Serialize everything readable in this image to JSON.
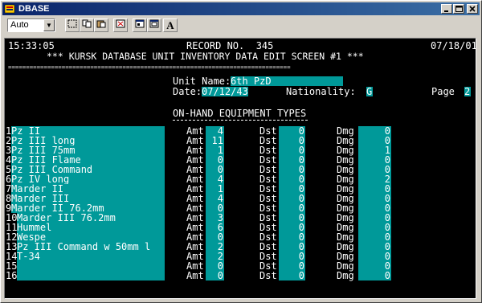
{
  "window": {
    "title": "DBASE"
  },
  "toolbar": {
    "font_size": "Auto",
    "font_size_arrow": "▼",
    "a_label": "A"
  },
  "header": {
    "time": "15:33:05",
    "record": "RECORD NO.  345",
    "date": "07/18/01",
    "subtitle": "*** KURSK DATABASE UNIT INVENTORY DATA EDIT SCREEN #1 ***",
    "divider": "==============================================================================="
  },
  "unit": {
    "name_label": "Unit Name:",
    "name_value": "6th PzD",
    "date_label": "Date:",
    "date_value": "07/12/43",
    "nationality_label": "Nationality:",
    "nationality_value": "G",
    "page_label": "Page",
    "page_value": "2"
  },
  "section": {
    "title": "ON-HAND EQUIPMENT TYPES"
  },
  "labels": {
    "amt": "Amt",
    "dst": "Dst",
    "dmg": "Dmg"
  },
  "rows": [
    {
      "n": "1",
      "name": "Pz II",
      "amt": "4",
      "dst": "0",
      "dmg": "0"
    },
    {
      "n": "2",
      "name": "Pz III long",
      "amt": "11",
      "dst": "0",
      "dmg": "0"
    },
    {
      "n": "3",
      "name": "Pz III 75mm",
      "amt": "1",
      "dst": "0",
      "dmg": "1"
    },
    {
      "n": "4",
      "name": "Pz III Flame",
      "amt": "0",
      "dst": "0",
      "dmg": "0"
    },
    {
      "n": "5",
      "name": "Pz III Command",
      "amt": "0",
      "dst": "0",
      "dmg": "0"
    },
    {
      "n": "6",
      "name": "Pz IV long",
      "amt": "4",
      "dst": "0",
      "dmg": "2"
    },
    {
      "n": "7",
      "name": "Marder II",
      "amt": "1",
      "dst": "0",
      "dmg": "0"
    },
    {
      "n": "8",
      "name": "Marder III",
      "amt": "4",
      "dst": "0",
      "dmg": "0"
    },
    {
      "n": "9",
      "name": "Marder II 76.2mm",
      "amt": "0",
      "dst": "0",
      "dmg": "0"
    },
    {
      "n": "10",
      "name": "Marder III 76.2mm",
      "amt": "3",
      "dst": "0",
      "dmg": "0"
    },
    {
      "n": "11",
      "name": "Hummel",
      "amt": "6",
      "dst": "0",
      "dmg": "0"
    },
    {
      "n": "12",
      "name": "Wespe",
      "amt": "0",
      "dst": "0",
      "dmg": "0"
    },
    {
      "n": "13",
      "name": "Pz III Command w 50mm l",
      "amt": "2",
      "dst": "0",
      "dmg": "0"
    },
    {
      "n": "14",
      "name": "T-34",
      "amt": "2",
      "dst": "0",
      "dmg": "0"
    },
    {
      "n": "15",
      "name": "",
      "amt": "0",
      "dst": "0",
      "dmg": "0"
    },
    {
      "n": "16",
      "name": "",
      "amt": "0",
      "dst": "0",
      "dmg": "0"
    }
  ],
  "colors": {
    "field": "#009999",
    "screen": "#000000",
    "text": "#ffffff",
    "titlebar": "#0a246a"
  }
}
